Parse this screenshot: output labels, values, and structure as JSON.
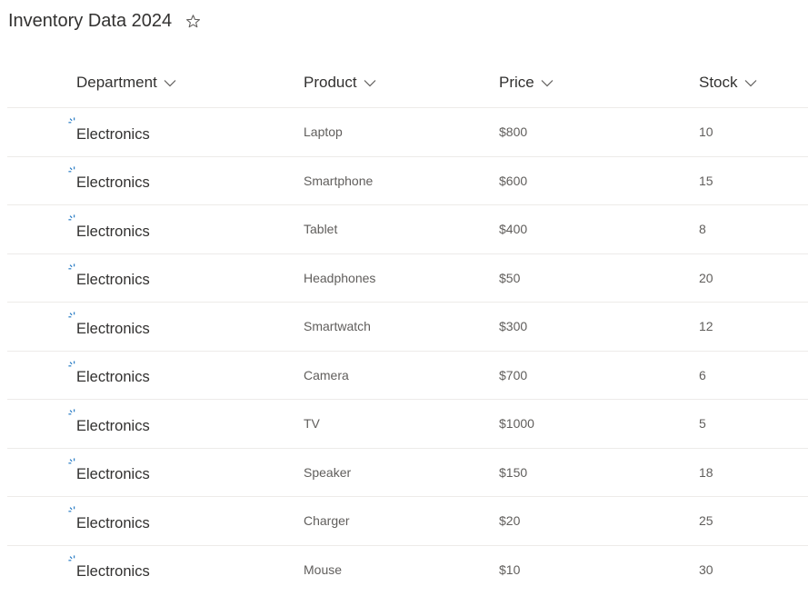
{
  "page": {
    "title": "Inventory Data 2024",
    "favorite_icon": "star-outline-icon"
  },
  "colors": {
    "spinner_accent": "#0f6cbd",
    "text_primary": "#323130",
    "text_secondary": "#605e5c",
    "divider": "#edebe9"
  },
  "table": {
    "columns": [
      {
        "label": "Department",
        "icon": "chevron-down-icon"
      },
      {
        "label": "Product",
        "icon": "chevron-down-icon"
      },
      {
        "label": "Price",
        "icon": "chevron-down-icon"
      },
      {
        "label": "Stock",
        "icon": "chevron-down-icon"
      }
    ],
    "rows": [
      {
        "department": "Electronics",
        "product": "Laptop",
        "price": "$800",
        "stock": "10"
      },
      {
        "department": "Electronics",
        "product": "Smartphone",
        "price": "$600",
        "stock": "15"
      },
      {
        "department": "Electronics",
        "product": "Tablet",
        "price": "$400",
        "stock": "8"
      },
      {
        "department": "Electronics",
        "product": "Headphones",
        "price": "$50",
        "stock": "20"
      },
      {
        "department": "Electronics",
        "product": "Smartwatch",
        "price": "$300",
        "stock": "12"
      },
      {
        "department": "Electronics",
        "product": "Camera",
        "price": "$700",
        "stock": "6"
      },
      {
        "department": "Electronics",
        "product": "TV",
        "price": "$1000",
        "stock": "5"
      },
      {
        "department": "Electronics",
        "product": "Speaker",
        "price": "$150",
        "stock": "18"
      },
      {
        "department": "Electronics",
        "product": "Charger",
        "price": "$20",
        "stock": "25"
      },
      {
        "department": "Electronics",
        "product": "Mouse",
        "price": "$10",
        "stock": "30"
      }
    ],
    "department_cell_icon": "loading-spinner-icon"
  }
}
